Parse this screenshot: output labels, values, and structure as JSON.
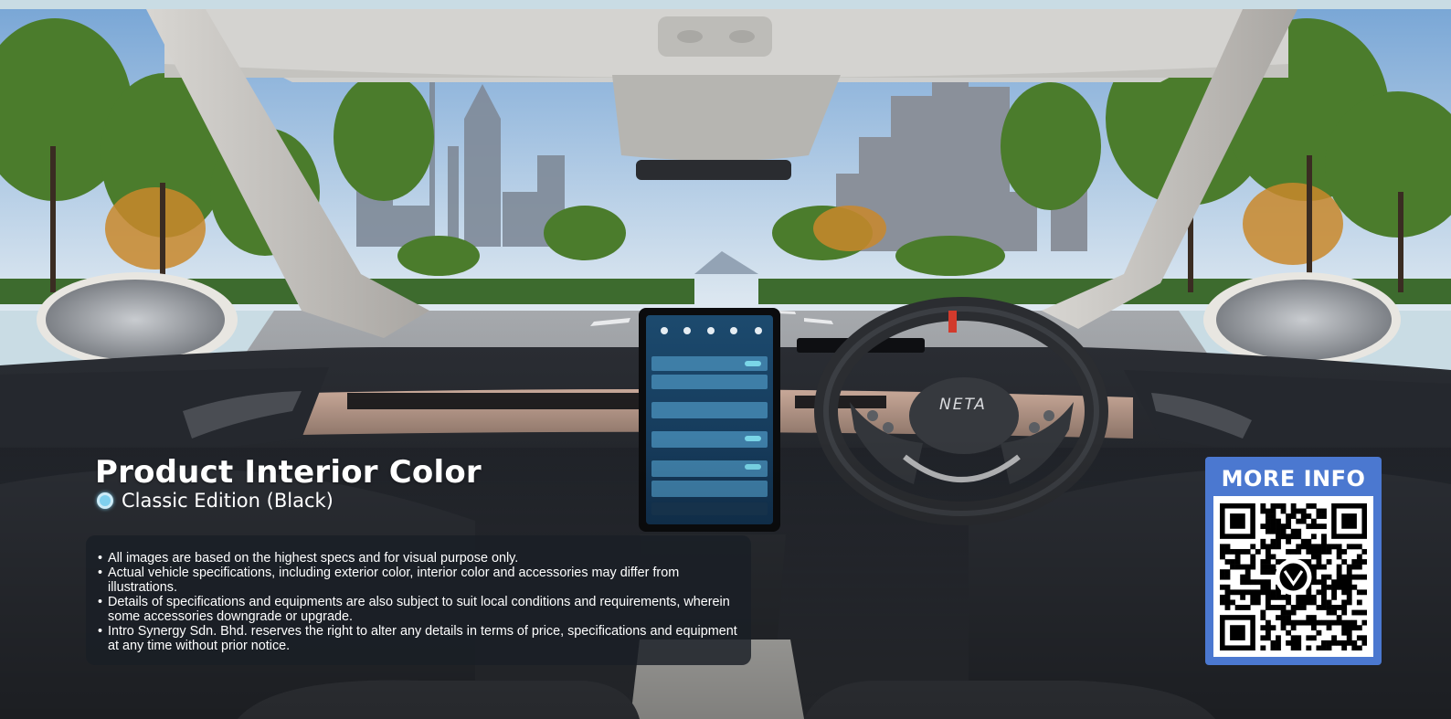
{
  "colors": {
    "page_strip": "#c9dce4",
    "more_info_bg": "#4b78d0",
    "note_bg": "#1a1e26",
    "edition_dot": "#7fd0ee",
    "steering_accent": "#d23a2c"
  },
  "hero": {
    "image": "car-interior-photo",
    "steering_logo": "NETA"
  },
  "product": {
    "title": "Product Interior Color",
    "edition": "Classic Edition (Black)"
  },
  "notes": [
    "All images are based on the highest specs and for visual purpose only.",
    "Actual vehicle specifications, including exterior color, interior color and accessories may differ from illustrations.",
    "Details of specifications and equipments are also subject to suit local conditions and requirements, wherein some accessories downgrade or upgrade.",
    "Intro Synergy Sdn. Bhd. reserves the right to alter any details in terms of price, specifications and equipment at any time without prior notice."
  ],
  "more_info": {
    "label": "MORE INFO",
    "qr_icon": "qr-code-icon",
    "qr_logo": "neta-logo-icon"
  }
}
